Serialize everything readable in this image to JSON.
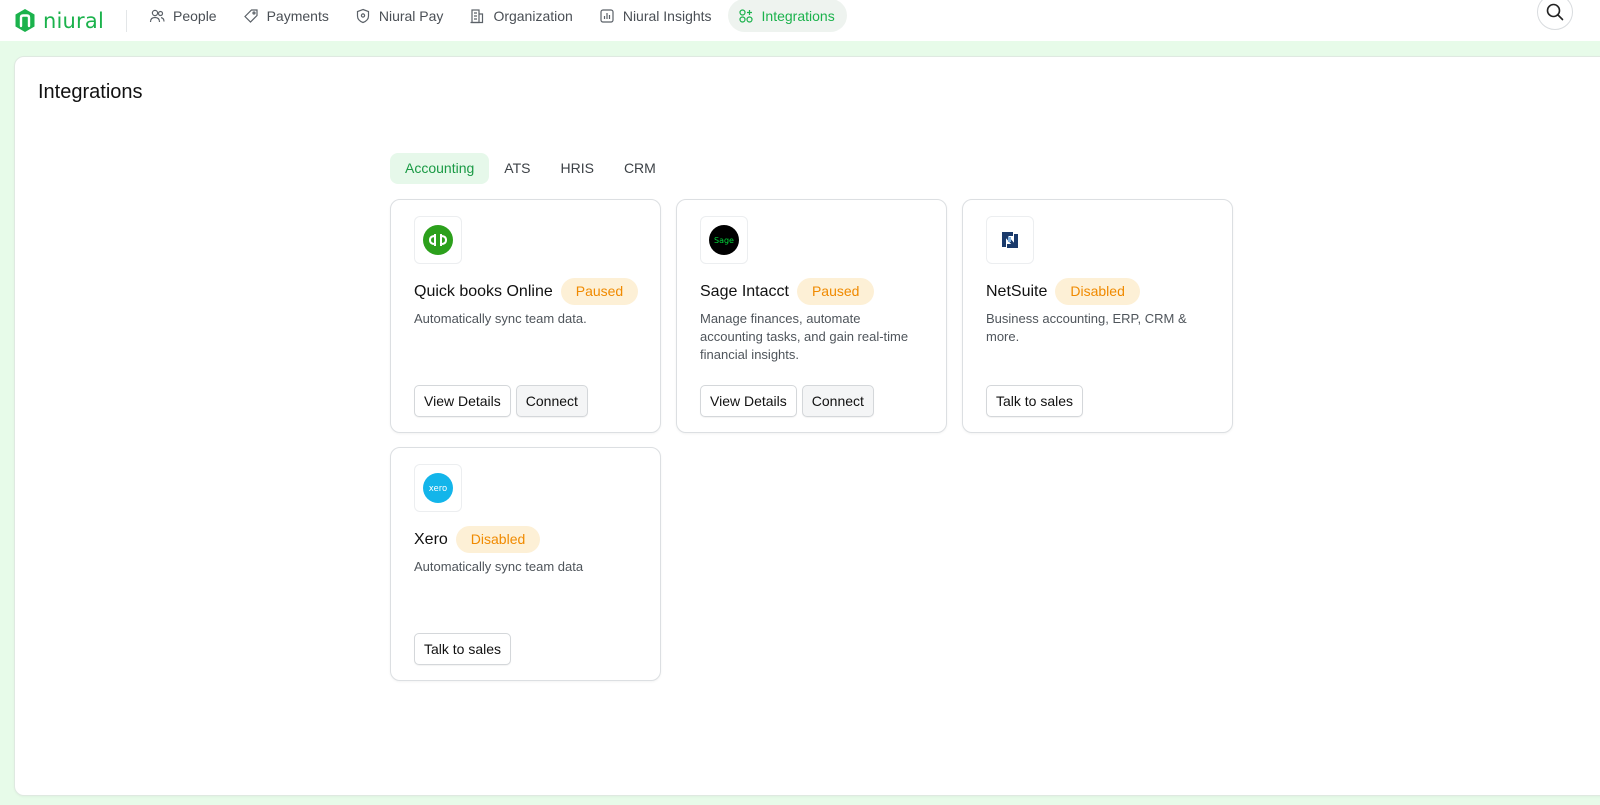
{
  "brand": {
    "name": "niural",
    "color": "#1bb24c"
  },
  "nav": {
    "items": [
      {
        "label": "People",
        "icon": "people-icon"
      },
      {
        "label": "Payments",
        "icon": "tag-icon"
      },
      {
        "label": "Niural Pay",
        "icon": "shield-icon"
      },
      {
        "label": "Organization",
        "icon": "building-icon"
      },
      {
        "label": "Niural Insights",
        "icon": "chart-icon"
      },
      {
        "label": "Integrations",
        "icon": "apps-icon",
        "active": true
      }
    ],
    "search_icon": "search-icon"
  },
  "page": {
    "title": "Integrations"
  },
  "tabs": [
    {
      "label": "Accounting",
      "active": true
    },
    {
      "label": "ATS"
    },
    {
      "label": "HRIS"
    },
    {
      "label": "CRM"
    }
  ],
  "cards": [
    {
      "name": "Quick books Online",
      "status": "Paused",
      "description": "Automatically sync team data.",
      "logo": "quickbooks-logo",
      "logo_text": "qb",
      "actions": [
        "View Details",
        "Connect"
      ]
    },
    {
      "name": "Sage Intacct",
      "status": "Paused",
      "description": "Manage finances, automate accounting tasks, and gain real-time financial insights.",
      "logo": "sage-logo",
      "logo_text": "Sage",
      "actions": [
        "View Details",
        "Connect"
      ]
    },
    {
      "name": "NetSuite",
      "status": "Disabled",
      "description": "Business accounting, ERP, CRM & more.",
      "logo": "netsuite-logo",
      "logo_text": "N",
      "actions": [
        "Talk to sales"
      ]
    },
    {
      "name": "Xero",
      "status": "Disabled",
      "description": "Automatically sync team data",
      "logo": "xero-logo",
      "logo_text": "xero",
      "actions": [
        "Talk to sales"
      ]
    }
  ],
  "colors": {
    "accent": "#1bb24c",
    "status_badge_bg": "#fdf0d6",
    "status_badge_text": "#f08a00",
    "backdrop": "#e7fbe9"
  }
}
